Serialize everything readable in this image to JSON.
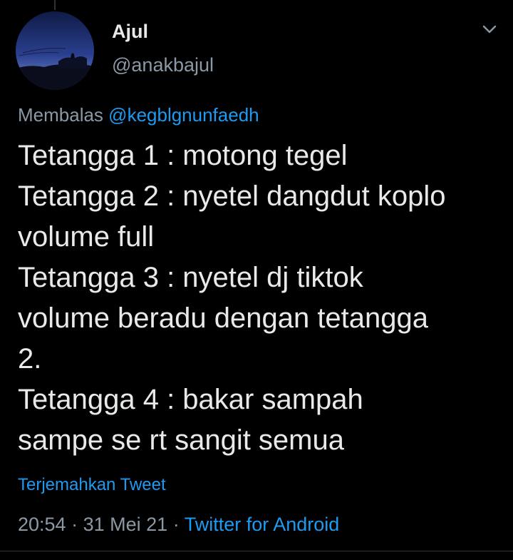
{
  "author": {
    "name": "Ajul",
    "handle": "@anakbajul"
  },
  "reply": {
    "prefix": "Membalas",
    "mention": "@kegblgnunfaedh"
  },
  "tweet": {
    "lines": [
      "Tetangga 1 : motong tegel",
      "Tetangga 2 : nyetel dangdut koplo",
      "volume full",
      "Tetangga 3 : nyetel dj tiktok",
      "volume beradu dengan tetangga",
      "2.",
      "Tetangga 4 : bakar sampah",
      "sampe se rt sangit semua"
    ]
  },
  "translate_label": "Terjemahkan Tweet",
  "meta": {
    "time": "20:54",
    "separator": "·",
    "date": "31 Mei 21",
    "source": "Twitter for Android"
  },
  "icons": {
    "menu": "chevron-down-icon"
  },
  "colors": {
    "background": "#000000",
    "text": "#e7e9ea",
    "secondary": "#8b98a5",
    "accent": "#1d9bf0"
  }
}
